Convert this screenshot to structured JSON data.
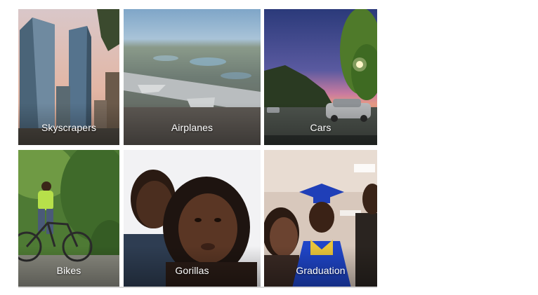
{
  "albums": [
    {
      "label": "Skyscrapers"
    },
    {
      "label": "Airplanes"
    },
    {
      "label": "Cars"
    },
    {
      "label": "Bikes"
    },
    {
      "label": "Gorillas"
    },
    {
      "label": "Graduation"
    }
  ]
}
